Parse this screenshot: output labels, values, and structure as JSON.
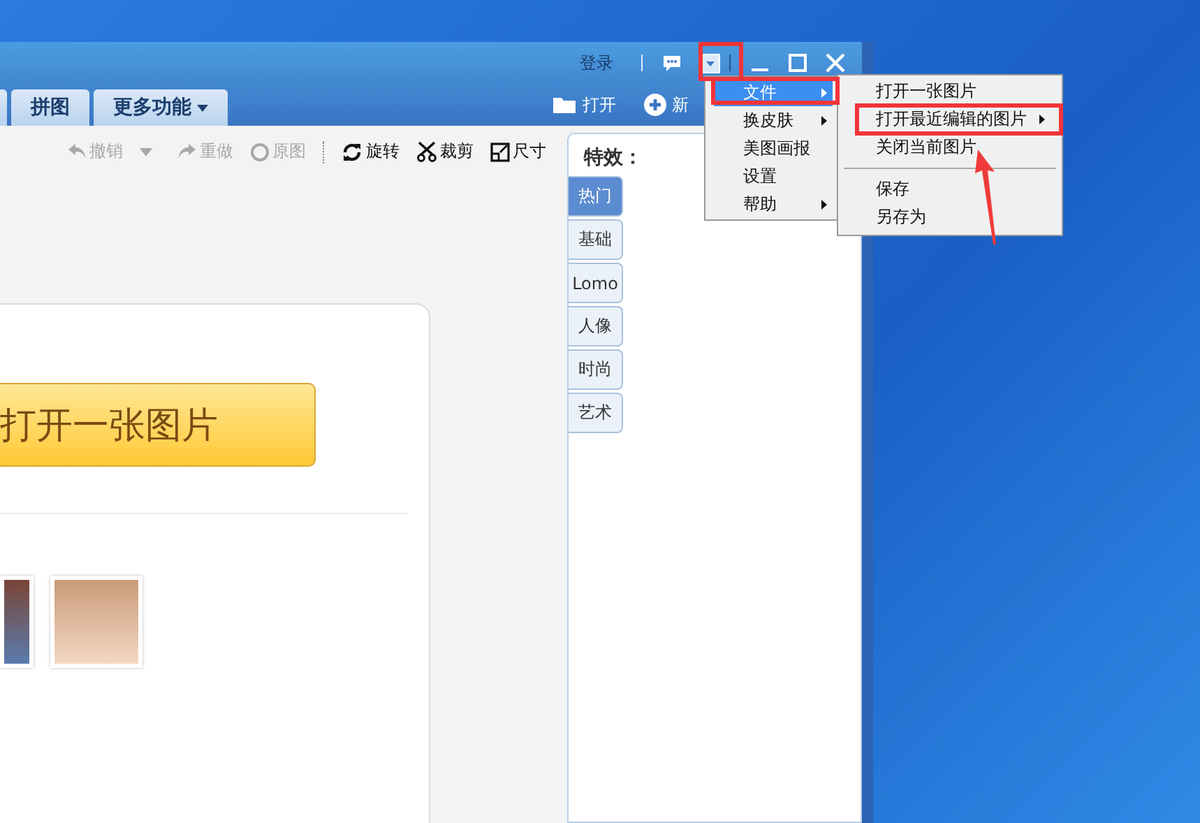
{
  "title_bar": {
    "login": "登录"
  },
  "tabs": [
    {
      "label": "拼图",
      "kind": "plain",
      "selected": false
    },
    {
      "label": "更多功能",
      "kind": "menu",
      "selected": false
    }
  ],
  "quick_actions": [
    {
      "label": "打开",
      "kind": "folder"
    },
    {
      "label": "新",
      "kind": "plus"
    }
  ],
  "toolbar": [
    {
      "kind": "undo",
      "label": "撤销",
      "disabled": true
    },
    {
      "kind": "caret",
      "disabled": true
    },
    {
      "kind": "redo",
      "label": "重做",
      "disabled": true
    },
    {
      "kind": "original",
      "label": "原图",
      "disabled": true
    },
    {
      "kind": "separator"
    },
    {
      "kind": "rotate",
      "label": "旋转",
      "disabled": false
    },
    {
      "kind": "crop",
      "label": "裁剪",
      "disabled": false
    },
    {
      "kind": "resize",
      "label": "尺寸",
      "disabled": false
    }
  ],
  "canvas": {
    "open_button": "打开一张图片"
  },
  "effects_panel": {
    "title": "特效：",
    "tabs": [
      {
        "label": "热门",
        "selected": true
      },
      {
        "label": "基础",
        "selected": false
      },
      {
        "label": "Lomo",
        "selected": false
      },
      {
        "label": "人像",
        "selected": false
      },
      {
        "label": "时尚",
        "selected": false
      },
      {
        "label": "艺术",
        "selected": false
      }
    ]
  },
  "main_menu": [
    {
      "label": "文件",
      "selected": true,
      "submenu": true
    },
    {
      "label": "换皮肤",
      "selected": false,
      "submenu": true
    },
    {
      "label": "美图画报",
      "selected": false,
      "submenu": false
    },
    {
      "label": "设置",
      "selected": false,
      "submenu": false
    },
    {
      "label": "帮助",
      "selected": false,
      "submenu": true
    }
  ],
  "file_submenu": [
    {
      "kind": "item",
      "label": "打开一张图片",
      "selected": false,
      "submenu": false
    },
    {
      "kind": "item",
      "label": "打开最近编辑的图片",
      "selected": false,
      "submenu": true
    },
    {
      "kind": "item",
      "label": "关闭当前图片",
      "selected": false,
      "submenu": false
    },
    {
      "kind": "separator"
    },
    {
      "kind": "item",
      "label": "保存",
      "selected": false,
      "submenu": false
    },
    {
      "kind": "item",
      "label": "另存为",
      "selected": false,
      "submenu": false
    }
  ]
}
